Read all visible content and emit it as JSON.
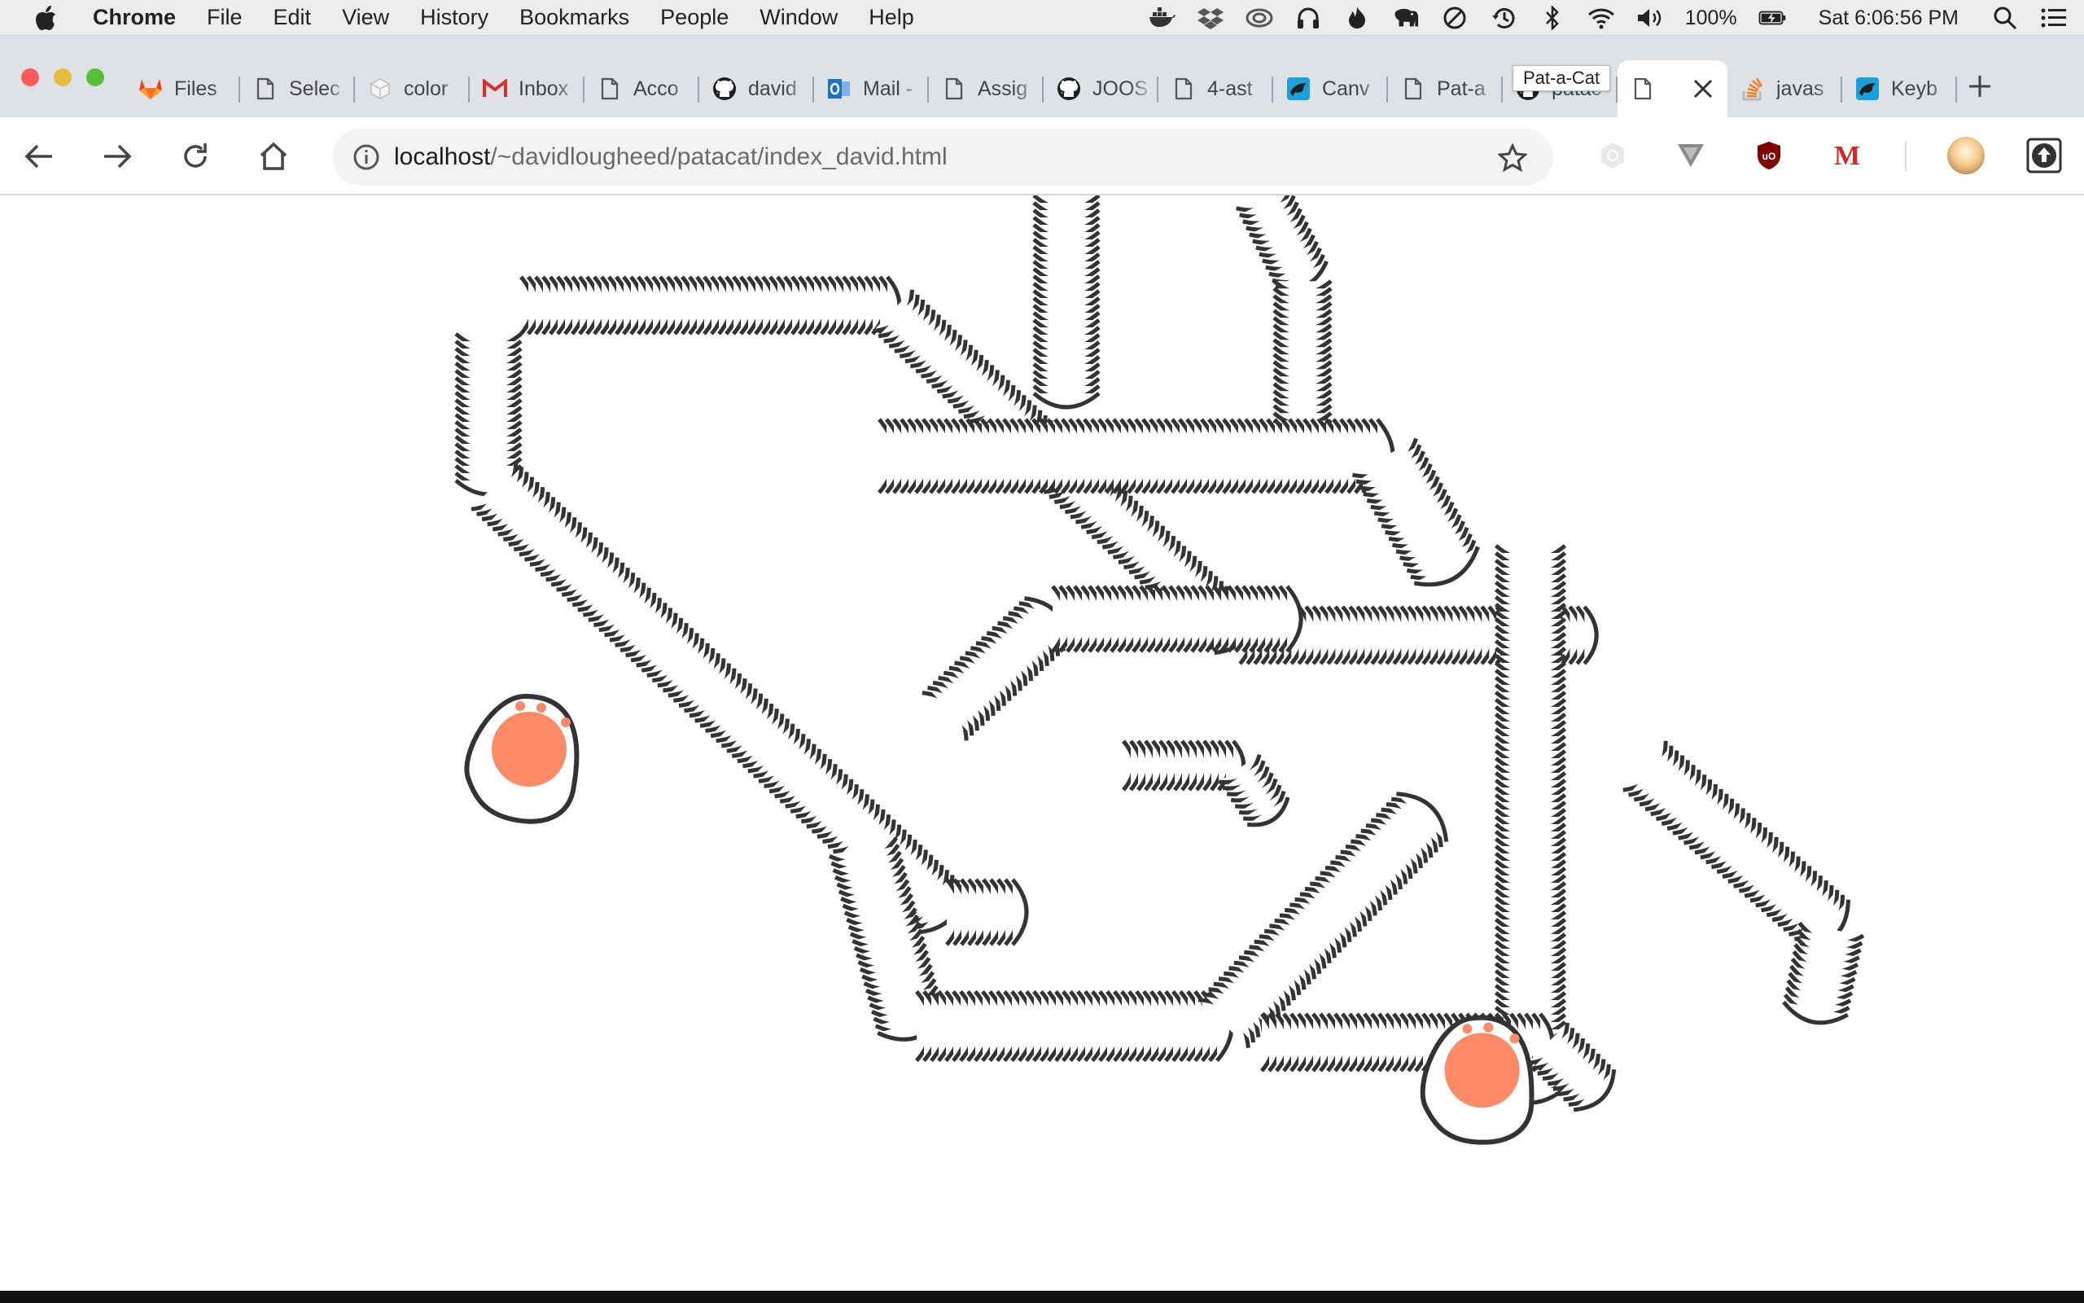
{
  "menubar": {
    "app_name": "Chrome",
    "items": [
      "File",
      "Edit",
      "View",
      "History",
      "Bookmarks",
      "People",
      "Window",
      "Help"
    ],
    "battery": "100%",
    "clock": "Sat 6:06:56 PM"
  },
  "tabs": [
    {
      "label": "Files",
      "icon": "gitlab-icon"
    },
    {
      "label": "Selec",
      "icon": "document-icon"
    },
    {
      "label": "color",
      "icon": "cube-icon"
    },
    {
      "label": "Inbox",
      "icon": "gmail-icon"
    },
    {
      "label": "Acco",
      "icon": "document-icon"
    },
    {
      "label": "david",
      "icon": "github-icon"
    },
    {
      "label": "Mail -",
      "icon": "outlook-icon"
    },
    {
      "label": "Assig",
      "icon": "document-icon"
    },
    {
      "label": "JOOS",
      "icon": "github-icon"
    },
    {
      "label": "4-ast",
      "icon": "document-icon"
    },
    {
      "label": "Canv",
      "icon": "canvas-icon"
    },
    {
      "label": "Pat-a",
      "icon": "document-icon"
    },
    {
      "label": "patac",
      "icon": "github-icon"
    }
  ],
  "tabs_after": [
    {
      "label": "javas",
      "icon": "stackoverflow-icon"
    },
    {
      "label": "Keyb",
      "icon": "canvas-icon"
    }
  ],
  "active_tab_tooltip": "Pat-a-Cat",
  "address": {
    "host": "localhost",
    "path": "/~davidlougheed/patacat/index_david.html"
  },
  "colors": {
    "accent_paw": "#fd8a66",
    "stroke": "#333333",
    "tabstrip": "#dee1e6"
  }
}
